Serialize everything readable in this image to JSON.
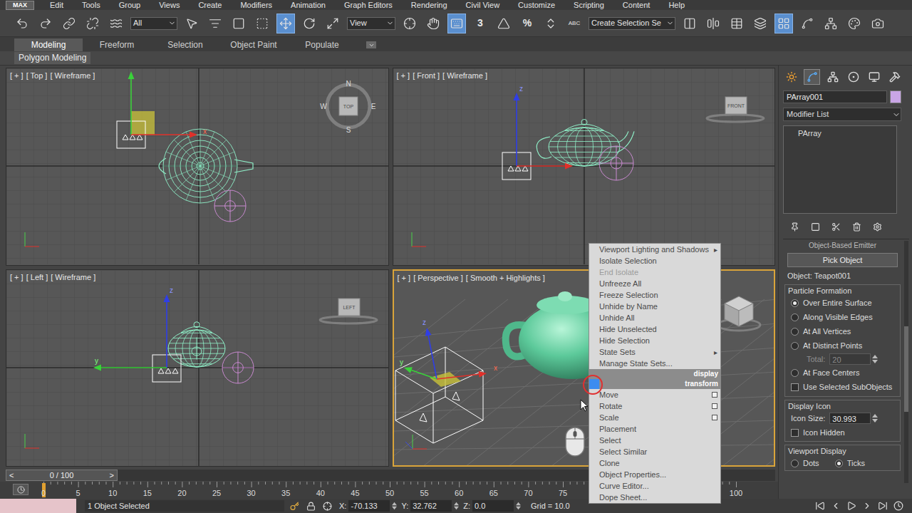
{
  "menu_bar": {
    "logo": "MAX",
    "items": [
      "Edit",
      "Tools",
      "Group",
      "Views",
      "Create",
      "Modifiers",
      "Animation",
      "Graph Editors",
      "Rendering",
      "Civil View",
      "Customize",
      "Scripting",
      "Content",
      "Help"
    ]
  },
  "toolbar": {
    "items": [
      {
        "kind": "button",
        "tool": "undo",
        "active": false
      },
      {
        "kind": "button",
        "tool": "redo",
        "active": false
      },
      {
        "kind": "button",
        "tool": "select-and-link",
        "active": false
      },
      {
        "kind": "button",
        "tool": "unlink-selection",
        "active": false
      },
      {
        "kind": "button",
        "tool": "bind-to-space-warp",
        "active": false
      },
      {
        "kind": "dropdown",
        "tool": "selection-filter",
        "value": "All"
      },
      {
        "kind": "button",
        "tool": "select-object",
        "active": false
      },
      {
        "kind": "button",
        "tool": "select-by-name",
        "active": false
      },
      {
        "kind": "button",
        "tool": "rectangular-selection",
        "active": false
      },
      {
        "kind": "button",
        "tool": "window-crossing",
        "active": false
      },
      {
        "kind": "button",
        "tool": "select-and-move",
        "active": true
      },
      {
        "kind": "button",
        "tool": "select-and-rotate",
        "active": false
      },
      {
        "kind": "button",
        "tool": "select-and-scale",
        "active": false
      },
      {
        "kind": "dropdown",
        "tool": "reference-coordinate-system",
        "value": "View"
      },
      {
        "kind": "button",
        "tool": "use-pivot-center",
        "active": false
      },
      {
        "kind": "button",
        "tool": "select-and-manipulate",
        "active": false
      },
      {
        "kind": "button",
        "tool": "keyboard-shortcut-override",
        "active": true
      },
      {
        "kind": "text-button",
        "tool": "snaps-toggle",
        "text": "3",
        "active": false
      },
      {
        "kind": "button",
        "tool": "angle-snap",
        "active": false
      },
      {
        "kind": "text-button",
        "tool": "percent-snap",
        "text": "%",
        "active": false
      },
      {
        "kind": "button",
        "tool": "spinner-snap",
        "active": false
      },
      {
        "kind": "text-button",
        "tool": "edit-named-selection-sets",
        "text": "ABC",
        "active": false
      },
      {
        "kind": "dropdown",
        "tool": "named-selection-sets",
        "value": "Create Selection Se"
      },
      {
        "kind": "button",
        "tool": "mirror",
        "active": false
      },
      {
        "kind": "button",
        "tool": "align",
        "active": false
      },
      {
        "kind": "button",
        "tool": "manage-layers",
        "active": false
      },
      {
        "kind": "button",
        "tool": "layer-explorer",
        "active": false
      },
      {
        "kind": "button",
        "tool": "toggle-ribbon",
        "active": true
      },
      {
        "kind": "button",
        "tool": "curve-editor",
        "active": false
      },
      {
        "kind": "button",
        "tool": "schematic-view",
        "active": false
      },
      {
        "kind": "button",
        "tool": "material-editor",
        "active": false
      },
      {
        "kind": "button",
        "tool": "render-setup",
        "active": false
      }
    ]
  },
  "ribbon": {
    "tabs": [
      {
        "label": "Modeling",
        "selected": true
      },
      {
        "label": "Freeform",
        "selected": false
      },
      {
        "label": "Selection",
        "selected": false
      },
      {
        "label": "Object Paint",
        "selected": false
      },
      {
        "label": "Populate",
        "selected": false
      }
    ],
    "panel": "Polygon Modeling"
  },
  "viewports": [
    {
      "view": "top",
      "label": [
        "[ + ]",
        "[ Top ]",
        "[ Wireframe ]"
      ],
      "active": false,
      "cube": "TOP",
      "compass": [
        "N",
        "E",
        "S",
        "W"
      ],
      "axes": [
        "x"
      ]
    },
    {
      "view": "front",
      "label": [
        "[ + ]",
        "[ Front ]",
        "[ Wireframe ]"
      ],
      "active": false,
      "cube": "FRONT",
      "compass": [],
      "axes": [
        "z"
      ]
    },
    {
      "view": "left",
      "label": [
        "[ + ]",
        "[ Left ]",
        "[ Wireframe ]"
      ],
      "active": false,
      "cube": "LEFT",
      "compass": [],
      "axes": [
        "z",
        "y"
      ]
    },
    {
      "view": "perspective",
      "label": [
        "[ + ]",
        "[ Perspective ]",
        "[ Smooth + Highlights ]"
      ],
      "active": true,
      "compass": [],
      "axes": [
        "z",
        "y",
        "x"
      ]
    }
  ],
  "quad_menu": {
    "submenu_arrow": "▸",
    "items": [
      {
        "label": "Viewport Lighting and Shadows",
        "kind": "submenu",
        "disabled": false,
        "highlighted": false
      },
      {
        "label": "Isolate Selection",
        "kind": "item",
        "disabled": false,
        "highlighted": false
      },
      {
        "label": "End Isolate",
        "kind": "item",
        "disabled": true,
        "highlighted": false
      },
      {
        "label": "Unfreeze All",
        "kind": "item",
        "disabled": false,
        "highlighted": false
      },
      {
        "label": "Freeze Selection",
        "kind": "item",
        "disabled": false,
        "highlighted": false
      },
      {
        "label": "Unhide by Name",
        "kind": "item",
        "disabled": false,
        "highlighted": false
      },
      {
        "label": "Unhide All",
        "kind": "item",
        "disabled": false,
        "highlighted": false
      },
      {
        "label": "Hide Unselected",
        "kind": "item",
        "disabled": false,
        "highlighted": false
      },
      {
        "label": "Hide Selection",
        "kind": "item",
        "disabled": false,
        "highlighted": false
      },
      {
        "label": "State Sets",
        "kind": "submenu",
        "disabled": false,
        "highlighted": false
      },
      {
        "label": "Manage State Sets...",
        "kind": "item",
        "disabled": false,
        "highlighted": false
      },
      {
        "label": "display",
        "kind": "header",
        "disabled": false,
        "highlighted": false
      },
      {
        "label": "transform",
        "kind": "header",
        "disabled": false,
        "highlighted": true
      },
      {
        "label": "Move",
        "kind": "option",
        "disabled": false,
        "highlighted": false
      },
      {
        "label": "Rotate",
        "kind": "option",
        "disabled": false,
        "highlighted": false
      },
      {
        "label": "Scale",
        "kind": "option",
        "disabled": false,
        "highlighted": false
      },
      {
        "label": "Placement",
        "kind": "item",
        "disabled": false,
        "highlighted": false
      },
      {
        "label": "Select",
        "kind": "item",
        "disabled": false,
        "highlighted": false
      },
      {
        "label": "Select Similar",
        "kind": "item",
        "disabled": false,
        "highlighted": false
      },
      {
        "label": "Clone",
        "kind": "item",
        "disabled": false,
        "highlighted": false
      },
      {
        "label": "Object Properties...",
        "kind": "item",
        "disabled": false,
        "highlighted": false
      },
      {
        "label": "Curve Editor...",
        "kind": "item",
        "disabled": false,
        "highlighted": false
      },
      {
        "label": "Dope Sheet...",
        "kind": "item",
        "disabled": false,
        "highlighted": false
      }
    ]
  },
  "command_panel": {
    "tabs": [
      {
        "panel": "create",
        "selected": false
      },
      {
        "panel": "modify",
        "selected": true
      },
      {
        "panel": "hierarchy",
        "selected": false
      },
      {
        "panel": "motion",
        "selected": false
      },
      {
        "panel": "display",
        "selected": false
      },
      {
        "panel": "utilities",
        "selected": false
      }
    ],
    "object_name": "PArray001",
    "object_color": "#c9a6e6",
    "modifier_list": "Modifier List",
    "stack": [
      {
        "label": "PArray",
        "selected": false
      }
    ],
    "rollout_title": "Object-Based Emitter",
    "pick_button": "Pick Object",
    "object_label": "Object: Teapot001",
    "particle_formation": {
      "title": "Particle Formation",
      "options": [
        {
          "label": "Over Entire Surface",
          "selected": true
        },
        {
          "label": "Along Visible Edges",
          "selected": false
        },
        {
          "label": "At All Vertices",
          "selected": false
        },
        {
          "label": "At Distinct Points",
          "selected": false
        },
        {
          "label": "At Face Centers",
          "selected": false
        }
      ],
      "total_label": "Total:",
      "total_value": "20",
      "total_disabled": true,
      "use_subobjects": {
        "label": "Use Selected SubObjects",
        "checked": false
      }
    },
    "display_icon": {
      "title": "Display Icon",
      "size_label": "Icon Size:",
      "size_value": "30.993",
      "hidden": {
        "label": "Icon Hidden",
        "checked": false
      }
    },
    "viewport_display": {
      "title": "Viewport Display",
      "options": [
        {
          "label": "Dots",
          "selected": false
        },
        {
          "label": "Ticks",
          "selected": true
        }
      ]
    }
  },
  "time_slider": {
    "prev": "<",
    "position": "0 / 100",
    "next": ">",
    "level": 0
  },
  "timeline": {
    "ticks": [
      "0",
      "5",
      "10",
      "15",
      "20",
      "25",
      "30",
      "35",
      "40",
      "45",
      "50",
      "55",
      "60",
      "65",
      "70",
      "75",
      "100"
    ]
  },
  "status_bar": {
    "prompt": "1 Object Selected",
    "coords": [
      {
        "axis": "X:",
        "value": "-70.133"
      },
      {
        "axis": "Y:",
        "value": "32.762"
      },
      {
        "axis": "Z:",
        "value": "0.0"
      }
    ],
    "grid": "Grid = 10.0"
  }
}
